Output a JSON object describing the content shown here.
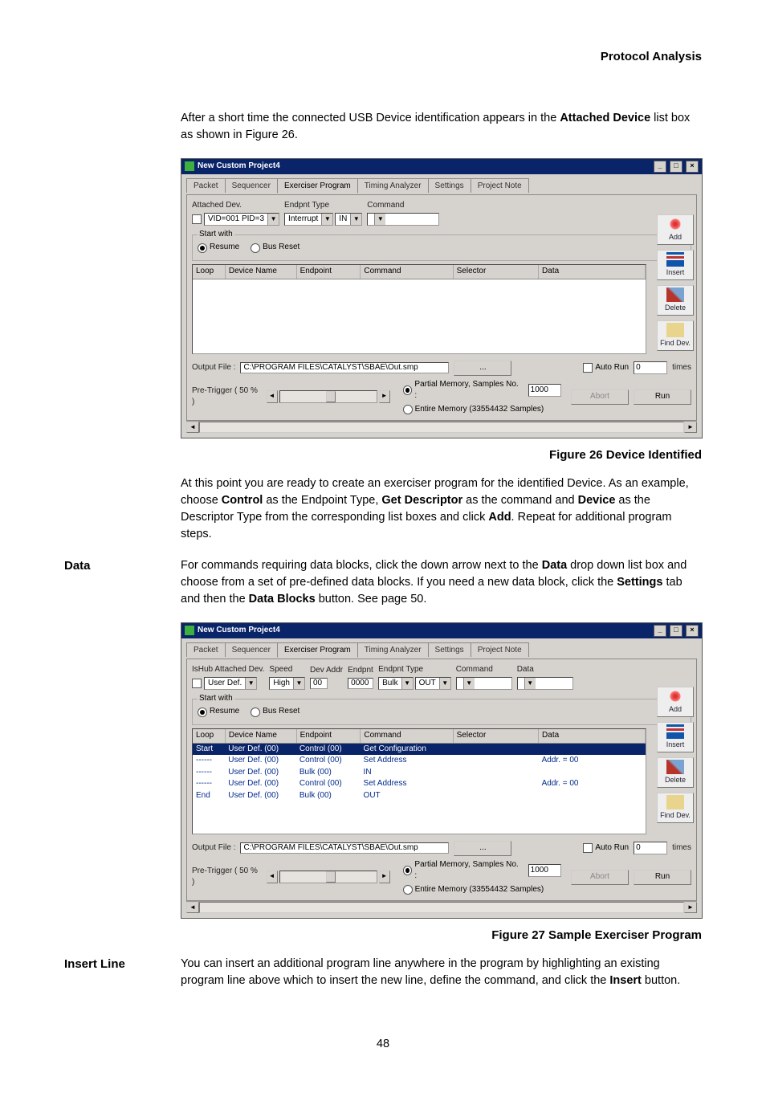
{
  "header": {
    "section_title": "Protocol Analysis"
  },
  "intro_para_pre": "After a short time the connected USB Device identification appears in the ",
  "intro_para_bold": "Attached Device",
  "intro_para_post": " list box as shown in Figure 26.",
  "shot1": {
    "title": "New Custom Project4",
    "tabs": [
      "Packet",
      "Sequencer",
      "Exerciser Program",
      "Timing Analyzer",
      "Settings",
      "Project Note"
    ],
    "active_tab": 2,
    "labels": {
      "attached_dev": "Attached Dev.",
      "endpnt_type": "Endpnt Type",
      "command": "Command",
      "start_with": "Start with",
      "resume": "Resume",
      "bus_reset": "Bus Reset"
    },
    "values": {
      "attached_dev": "VID=001 PID=3",
      "endpnt_type": "Interrupt",
      "direction": "IN",
      "command": ""
    },
    "grid_cols": [
      "Loop",
      "Device Name",
      "Endpoint",
      "Command",
      "Selector",
      "Data"
    ],
    "side_buttons": [
      "Add",
      "Insert",
      "Delete",
      "Find Dev."
    ],
    "output_label": "Output File :",
    "output_path": "C:\\PROGRAM FILES\\CATALYST\\SBAE\\Out.smp",
    "auto_run_label": "Auto Run",
    "auto_run_value": "0",
    "times_label": "times",
    "pretrigger_label": "Pre-Trigger ( 50 % )",
    "mem_partial": "Partial Memory,  Samples No. :",
    "mem_partial_val": "1000",
    "mem_entire": "Entire Memory (33554432 Samples)",
    "abort": "Abort",
    "run": "Run",
    "browse": "..."
  },
  "fig26_caption": "Figure  26  Device Identified",
  "para2": {
    "t1": "At this point you are ready to create an exerciser program for the identified Device. As an example, choose ",
    "b1": "Control",
    "t2": " as the Endpoint Type, ",
    "b2": "Get Descriptor",
    "t3": " as the command and ",
    "b3": "Device",
    "t4": " as the Descriptor Type from the corresponding list boxes and click ",
    "b4": "Add",
    "t5": ". Repeat for additional program steps."
  },
  "side_data": "Data",
  "para3": {
    "t1": "For commands requiring data blocks, click the down arrow next to the ",
    "b1": "Data",
    "t2": " drop down list box and choose from a set of pre-defined data blocks. If you need a new data block, click the ",
    "b2": "Settings",
    "t3": " tab and then the ",
    "b3": "Data Blocks",
    "t4": " button. See page 50."
  },
  "shot2": {
    "title": "New Custom Project4",
    "tabs": [
      "Packet",
      "Sequencer",
      "Exerciser Program",
      "Timing Analyzer",
      "Settings",
      "Project Note"
    ],
    "active_tab": 2,
    "labels": {
      "attached_dev": "IsHub Attached Dev.",
      "speed": "Speed",
      "dev_addr": "Dev Addr",
      "endpnt": "Endpnt",
      "endpnt_type": "Endpnt Type",
      "command": "Command",
      "data": "Data",
      "start_with": "Start with",
      "resume": "Resume",
      "bus_reset": "Bus Reset"
    },
    "values": {
      "attached_dev": "User Def.",
      "speed": "High",
      "dev_addr": "00",
      "endpnt": "0000",
      "endpnt_type": "Bulk",
      "direction": "OUT",
      "command": "",
      "data": ""
    },
    "grid_cols": [
      "Loop",
      "Device Name",
      "Endpoint",
      "Command",
      "Selector",
      "Data"
    ],
    "grid_rows": [
      {
        "loop": "Start",
        "dev": "User Def. (00)",
        "ep": "Control (00)",
        "cmd": "Get Configuration",
        "sel": "",
        "data": "",
        "sel_row": true
      },
      {
        "loop": "------",
        "dev": "User Def. (00)",
        "ep": "Control (00)",
        "cmd": "Set Address",
        "sel": "",
        "data": "Addr. = 00"
      },
      {
        "loop": "------",
        "dev": "User Def. (00)",
        "ep": "Bulk (00)",
        "cmd": "IN",
        "sel": "",
        "data": ""
      },
      {
        "loop": "------",
        "dev": "User Def. (00)",
        "ep": "Control (00)",
        "cmd": "Set Address",
        "sel": "",
        "data": "Addr. = 00"
      },
      {
        "loop": "End",
        "dev": "User Def. (00)",
        "ep": "Bulk (00)",
        "cmd": "OUT",
        "sel": "",
        "data": ""
      }
    ],
    "side_buttons": [
      "Add",
      "Insert",
      "Delete",
      "Find Dev."
    ],
    "output_label": "Output File :",
    "output_path": "C:\\PROGRAM FILES\\CATALYST\\SBAE\\Out.smp",
    "auto_run_label": "Auto Run",
    "auto_run_value": "0",
    "times_label": "times",
    "pretrigger_label": "Pre-Trigger ( 50 % )",
    "mem_partial": "Partial Memory,  Samples No. :",
    "mem_partial_val": "1000",
    "mem_entire": "Entire Memory (33554432 Samples)",
    "abort": "Abort",
    "run": "Run",
    "browse": "..."
  },
  "fig27_caption": "Figure  27  Sample Exerciser Program",
  "side_insert": "Insert Line",
  "para4": {
    "t1": "You can insert an additional program line anywhere in the program by highlighting an existing program line above which to insert the new line, define the command, and click the ",
    "b1": "Insert",
    "t2": " button."
  },
  "page_number": "48"
}
